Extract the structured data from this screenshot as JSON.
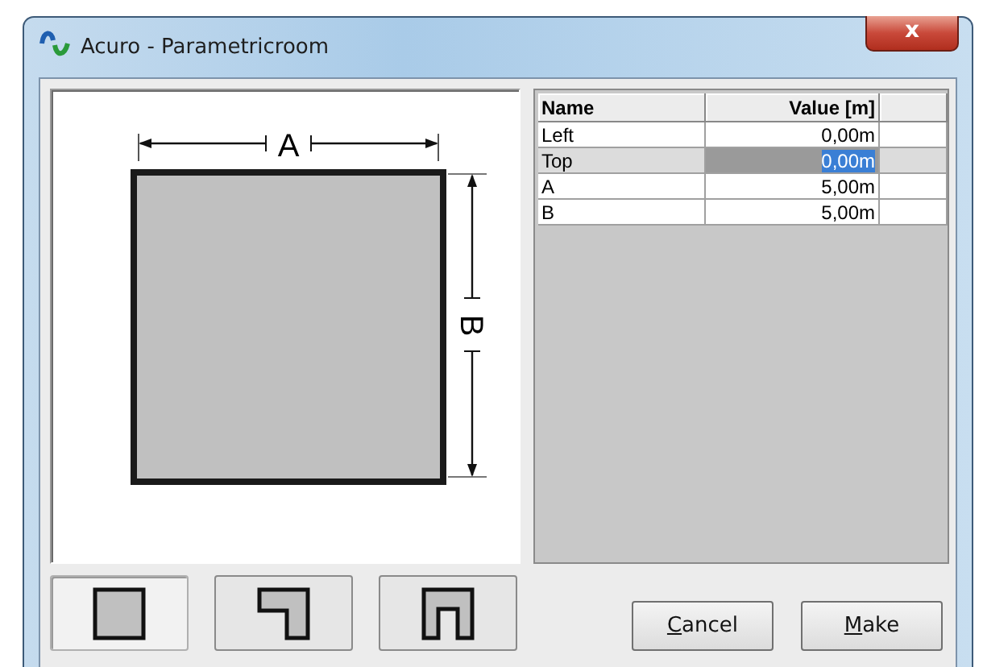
{
  "window": {
    "title": "Acuro - Parametricroom",
    "close": "x"
  },
  "drawing": {
    "width_label": "A",
    "height_label": "B"
  },
  "table": {
    "columns": [
      "Name",
      "Value [m]"
    ],
    "rows": [
      {
        "name": "Left",
        "value": "0,00m",
        "selected": false
      },
      {
        "name": "Top",
        "value": "0,00m",
        "selected": true
      },
      {
        "name": "A",
        "value": "5,00m",
        "selected": false
      },
      {
        "name": "B",
        "value": "5,00m",
        "selected": false
      }
    ]
  },
  "shapes": [
    {
      "kind": "rect",
      "selected": true
    },
    {
      "kind": "l-shape",
      "selected": false
    },
    {
      "kind": "u-shape",
      "selected": false
    }
  ],
  "buttons": [
    {
      "label": "Cancel"
    },
    {
      "label": "Make"
    }
  ]
}
